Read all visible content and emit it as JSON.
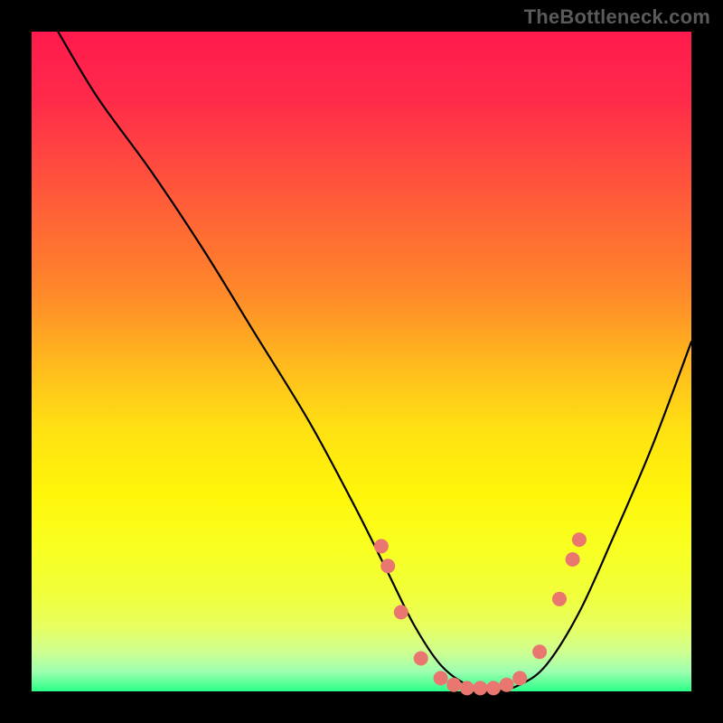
{
  "watermark": "TheBottleneck.com",
  "colors": {
    "frame": "#000000",
    "dot": "#e9766f",
    "curve": "#000000"
  },
  "chart_data": {
    "type": "line",
    "title": "",
    "xlabel": "",
    "ylabel": "",
    "xlim": [
      0,
      100
    ],
    "ylim": [
      0,
      100
    ],
    "grid": false,
    "legend": false,
    "series": [
      {
        "name": "bottleneck-curve",
        "x_pct": [
          4,
          10,
          18,
          26,
          34,
          42,
          49,
          54,
          58,
          62,
          66,
          70,
          74,
          78,
          83,
          88,
          94,
          100
        ],
        "y_pct": [
          100,
          90,
          79,
          67,
          54,
          41,
          28,
          18,
          10,
          4,
          1,
          0,
          1,
          4,
          12,
          23,
          37,
          53
        ],
        "note": "y_pct is percentage height from the bottom of the plot; values implied by visual shape (no axis labels present)"
      }
    ],
    "dots": {
      "name": "highlight-dots",
      "x_pct": [
        53,
        54,
        56,
        59,
        62,
        64,
        66,
        68,
        70,
        72,
        74,
        77,
        80,
        82,
        83
      ],
      "y_pct": [
        22,
        19,
        12,
        5,
        2,
        1,
        0.5,
        0.5,
        0.5,
        1,
        2,
        6,
        14,
        20,
        23
      ]
    }
  }
}
